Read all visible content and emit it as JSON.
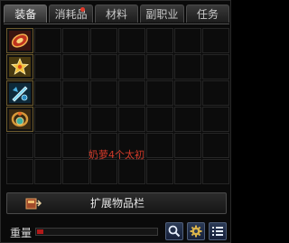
{
  "tabs": [
    {
      "label": "装备",
      "active": true
    },
    {
      "label": "消耗品",
      "badge": true
    },
    {
      "label": "材料"
    },
    {
      "label": "副职业"
    },
    {
      "label": "任务"
    }
  ],
  "grid": {
    "columns": 8,
    "rows": 6,
    "items": [
      {
        "icon": "red-bracer-icon"
      },
      {
        "icon": "golden-star-accessory-icon"
      },
      {
        "icon": "blue-crystal-weapon-icon"
      },
      {
        "icon": "bronze-orb-accessory-icon"
      }
    ],
    "message": "奶萝4个太初"
  },
  "expand": {
    "label": "扩展物品栏"
  },
  "weight": {
    "label": "重量",
    "fill_fraction": 0.05
  },
  "buttons": [
    {
      "icon": "search-icon"
    },
    {
      "icon": "gear-icon"
    },
    {
      "icon": "list-icon"
    }
  ],
  "colors": {
    "accent_red": "#d23a2a",
    "weight_fill": "#b21a1a"
  }
}
